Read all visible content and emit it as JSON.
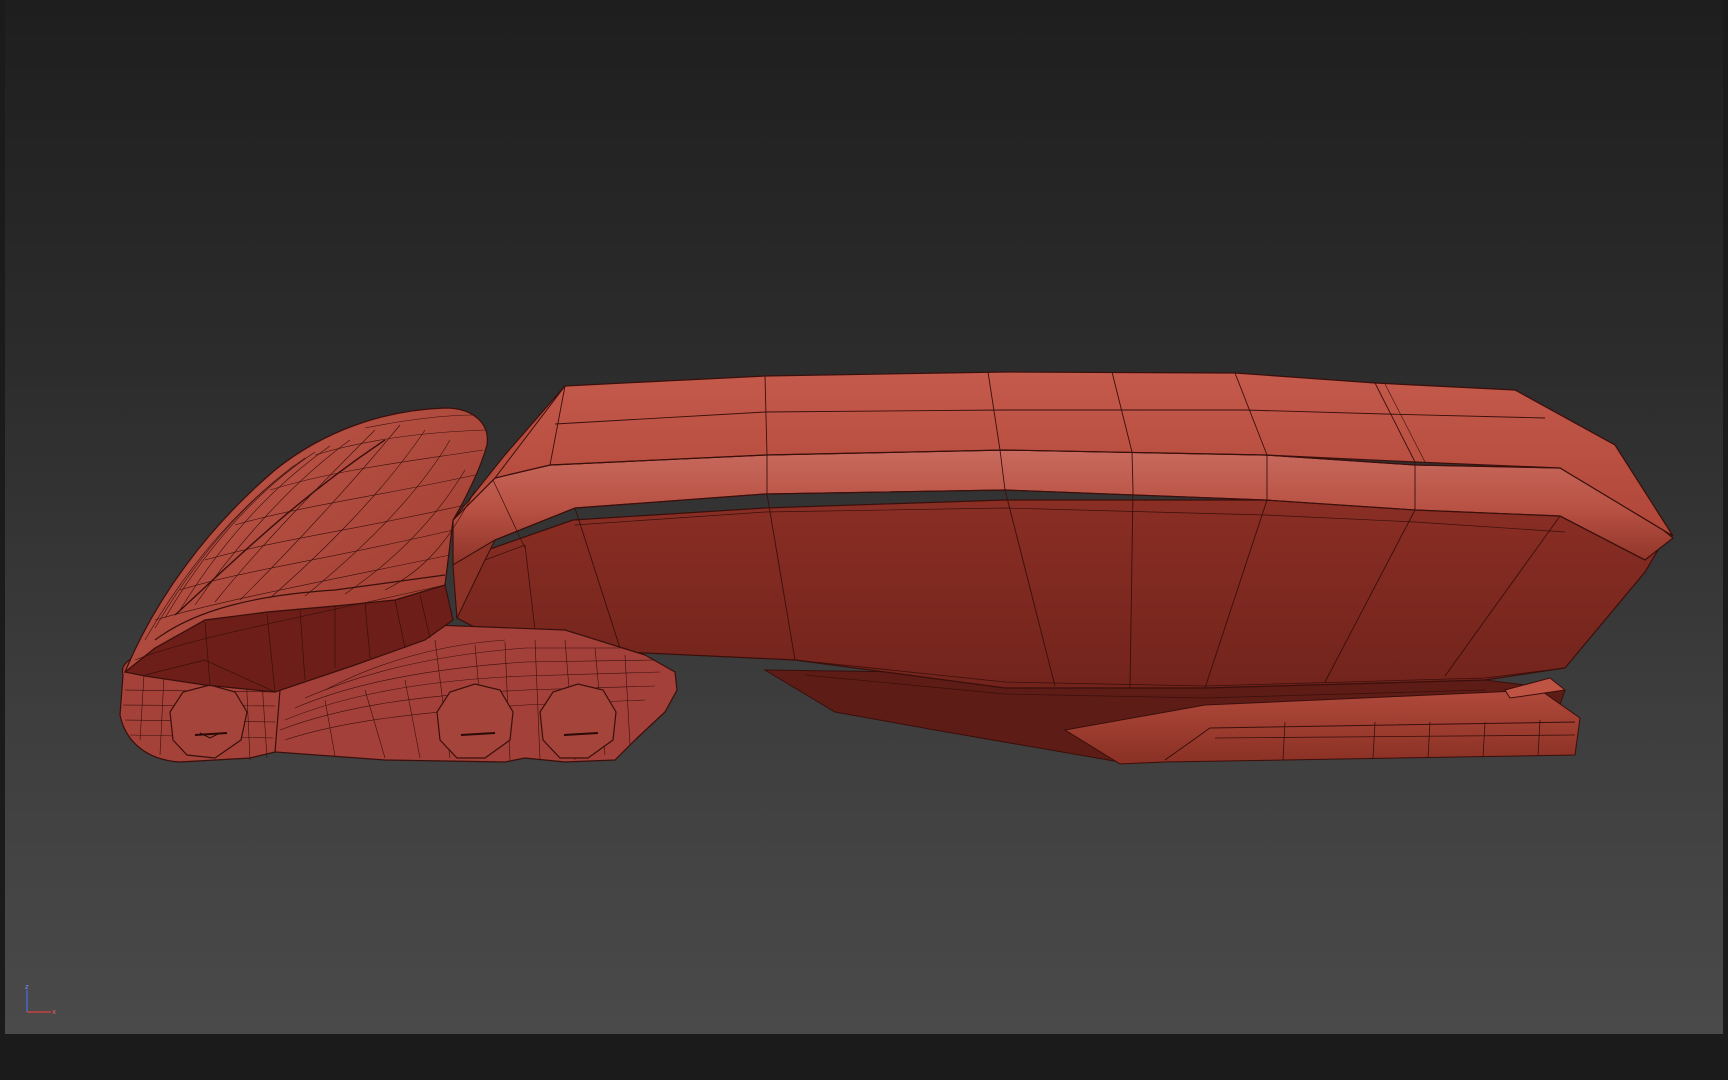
{
  "viewport": {
    "name": "3d-viewport",
    "background_top": "#1e1e1e",
    "background_bottom": "#4a4a4a"
  },
  "model": {
    "name": "truck-trailer-mesh",
    "shading_color": "#b24a3e",
    "shadow_color": "#7a2a22",
    "wire_color": "#3a0f0b",
    "display_mode": "shaded-with-wireframe"
  },
  "axis_gizmo": {
    "z_label": "z",
    "x_label": "x",
    "z_color": "#4a6cf0",
    "x_color": "#e04040"
  }
}
